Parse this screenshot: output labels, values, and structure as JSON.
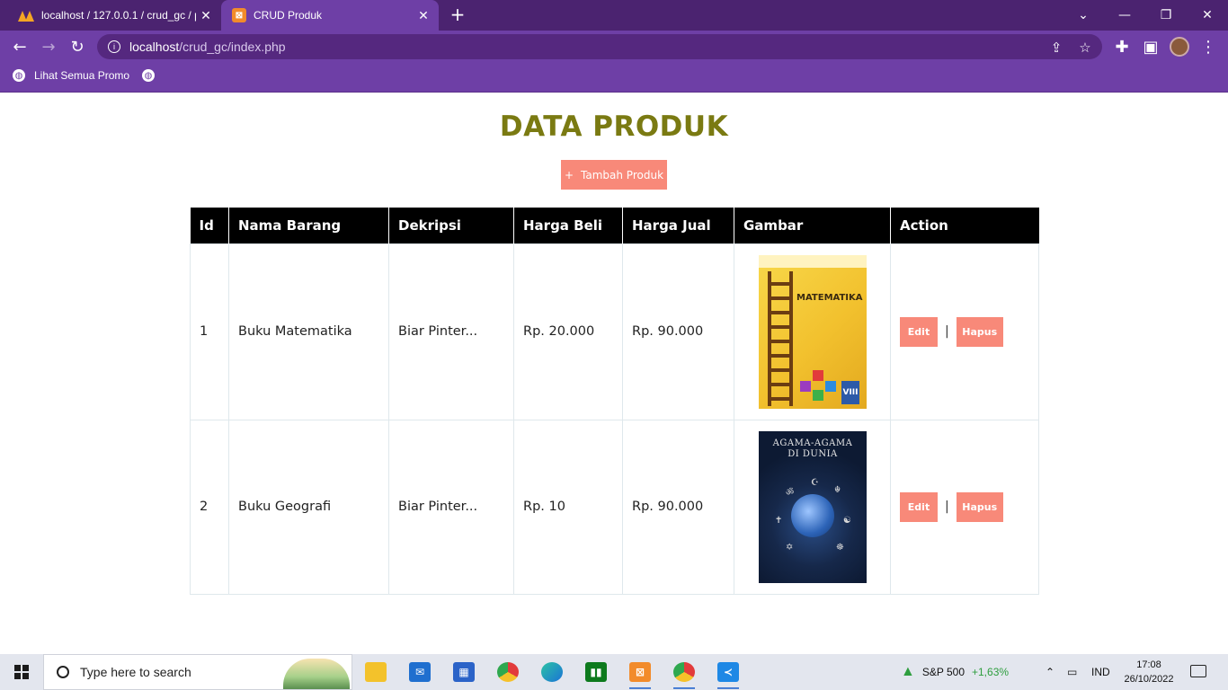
{
  "browser": {
    "tabs": [
      {
        "title": "localhost / 127.0.0.1 / crud_gc / p",
        "icon": "phpmyadmin-icon"
      },
      {
        "title": "CRUD Produk",
        "icon": "xampp-icon"
      }
    ],
    "url_host": "localhost",
    "url_path": "/crud_gc/index.php",
    "bookmarks": [
      {
        "label": "Lihat Semua Promo",
        "icon": "globe-icon"
      }
    ]
  },
  "page": {
    "title": "DATA PRODUK",
    "add_button": "Tambah Produk",
    "add_button_icon": "+",
    "accent_color": "#f88979",
    "title_color": "#7a7a12"
  },
  "table": {
    "headers": [
      "Id",
      "Nama Barang",
      "Dekripsi",
      "Harga Beli",
      "Harga Jual",
      "Gambar",
      "Action"
    ],
    "rows": [
      {
        "id": "1",
        "name": "Buku Matematika",
        "desc": "Biar Pinter...",
        "harga_beli": "Rp. 20.000",
        "harga_jual": "Rp. 90.000",
        "image_title": "MATEMATIKA",
        "image_label": "VIII",
        "edit": "Edit",
        "hapus": "Hapus"
      },
      {
        "id": "2",
        "name": "Buku Geografi",
        "desc": "Biar Pinter...",
        "harga_beli": "Rp. 10",
        "harga_jual": "Rp. 90.000",
        "image_title_1": "AGAMA-AGAMA",
        "image_title_2": "DI DUNIA",
        "edit": "Edit",
        "hapus": "Hapus"
      }
    ],
    "separator": "|"
  },
  "taskbar": {
    "search_placeholder": "Type here to search",
    "stock": "S&P 500",
    "stock_change": "+1,63%",
    "lang": "IND",
    "time": "17:08",
    "date": "26/10/2022"
  }
}
